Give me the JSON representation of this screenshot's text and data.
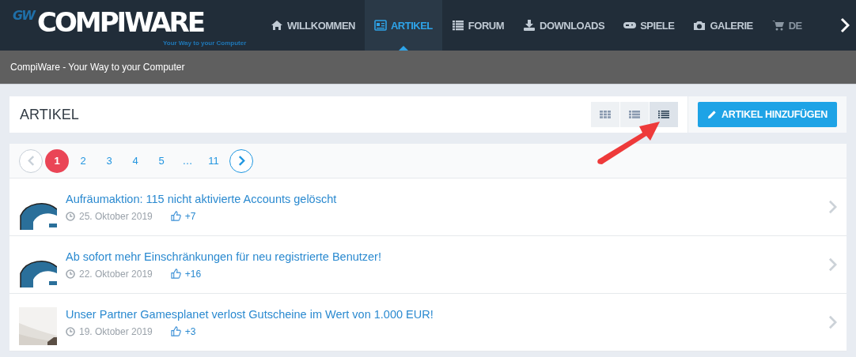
{
  "logo": {
    "mark": "GW",
    "name": "COMPIWARE",
    "slogan": "Your Way to your Computer"
  },
  "nav": [
    {
      "label": "WILLKOMMEN",
      "selected": false
    },
    {
      "label": "ARTIKEL",
      "selected": true
    },
    {
      "label": "FORUM",
      "selected": false
    },
    {
      "label": "DOWNLOADS",
      "selected": false
    },
    {
      "label": "SPIELE",
      "selected": false
    },
    {
      "label": "GALERIE",
      "selected": false
    },
    {
      "label": "DE",
      "selected": false
    }
  ],
  "subheader": "CompiWare - Your Way to your Computer",
  "section": {
    "title": "ARTIKEL",
    "add_button": "ARTIKEL HINZUFÜGEN"
  },
  "view_modes": [
    {
      "selected": false
    },
    {
      "selected": false
    },
    {
      "selected": true
    }
  ],
  "pagination": [
    {
      "kind": "page",
      "label": "1",
      "selected": true
    },
    {
      "kind": "page",
      "label": "2",
      "selected": false
    },
    {
      "kind": "page",
      "label": "3",
      "selected": false
    },
    {
      "kind": "page",
      "label": "4",
      "selected": false
    },
    {
      "kind": "page",
      "label": "5",
      "selected": false
    },
    {
      "kind": "ellipsis",
      "label": "…"
    },
    {
      "kind": "page",
      "label": "11",
      "selected": false
    }
  ],
  "articles": [
    {
      "title": "Aufräumaktion: 115 nicht aktivierte Accounts gelöscht",
      "date": "25. Oktober 2019",
      "likes": "+7",
      "kind": "logo"
    },
    {
      "title": "Ab sofort mehr Einschränkungen für neu registrierte Benutzer!",
      "date": "22. Oktober 2019",
      "likes": "+16",
      "kind": "logo"
    },
    {
      "title": "Unser Partner Gamesplanet verlost Gutscheine im Wert von 1.000 EUR!",
      "date": "19. Oktober 2019",
      "likes": "+3"
    }
  ]
}
